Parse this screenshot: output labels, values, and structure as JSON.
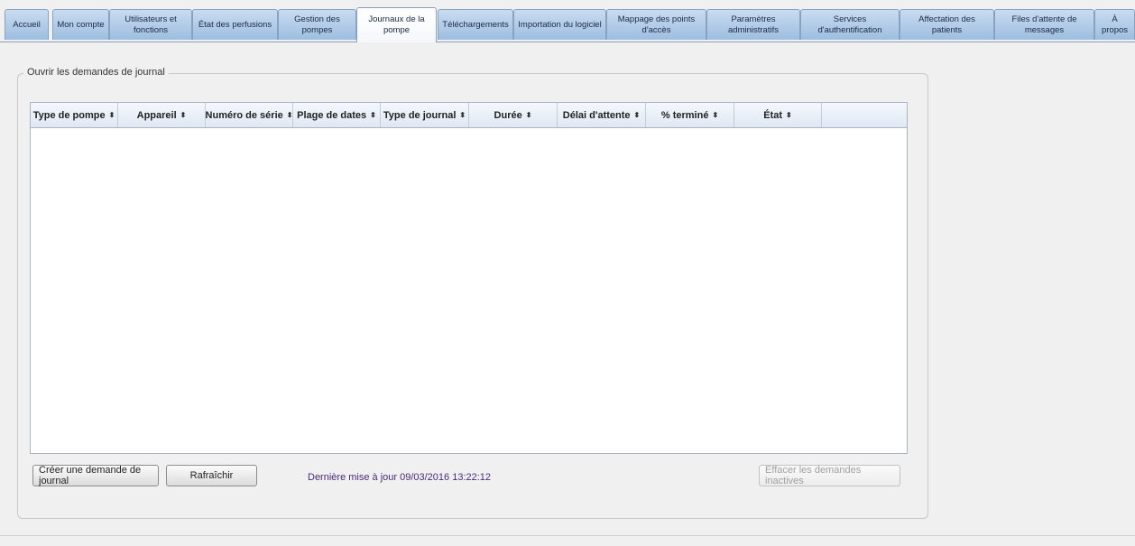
{
  "tabs": [
    {
      "label": "Accueil",
      "active": false
    },
    {
      "label": "Mon compte",
      "active": false
    },
    {
      "label": "Utilisateurs et fonctions",
      "active": false
    },
    {
      "label": "État des perfusions",
      "active": false
    },
    {
      "label": "Gestion des pompes",
      "active": false
    },
    {
      "label": "Journaux de la pompe",
      "active": true
    },
    {
      "label": "Téléchargements",
      "active": false
    },
    {
      "label": "Importation du logiciel",
      "active": false
    },
    {
      "label": "Mappage des points d'accès",
      "active": false
    },
    {
      "label": "Paramètres administratifs",
      "active": false
    },
    {
      "label": "Services d'authentification",
      "active": false
    },
    {
      "label": "Affectation des patients",
      "active": false
    },
    {
      "label": "Files d'attente de messages",
      "active": false
    },
    {
      "label": "À propos",
      "active": false
    }
  ],
  "panel": {
    "title": "Ouvrir les demandes de journal"
  },
  "table": {
    "columns": [
      "Type de pompe",
      "Appareil",
      "Numéro de série",
      "Plage de dates",
      "Type de journal",
      "Durée",
      "Délai d'attente",
      "% terminé",
      "État"
    ],
    "sort_icon": "⬍",
    "rows": []
  },
  "actions": {
    "create_label": "Créer une demande de journal",
    "refresh_label": "Rafraîchir",
    "clear_inactive_label": "Effacer les demandes inactives"
  },
  "status": {
    "last_update": "Dernière mise à jour 09/03/2016 13:22:12"
  },
  "colors": {
    "tab_fill": "#9dbde0",
    "last_update_text": "#4b2a7a"
  }
}
